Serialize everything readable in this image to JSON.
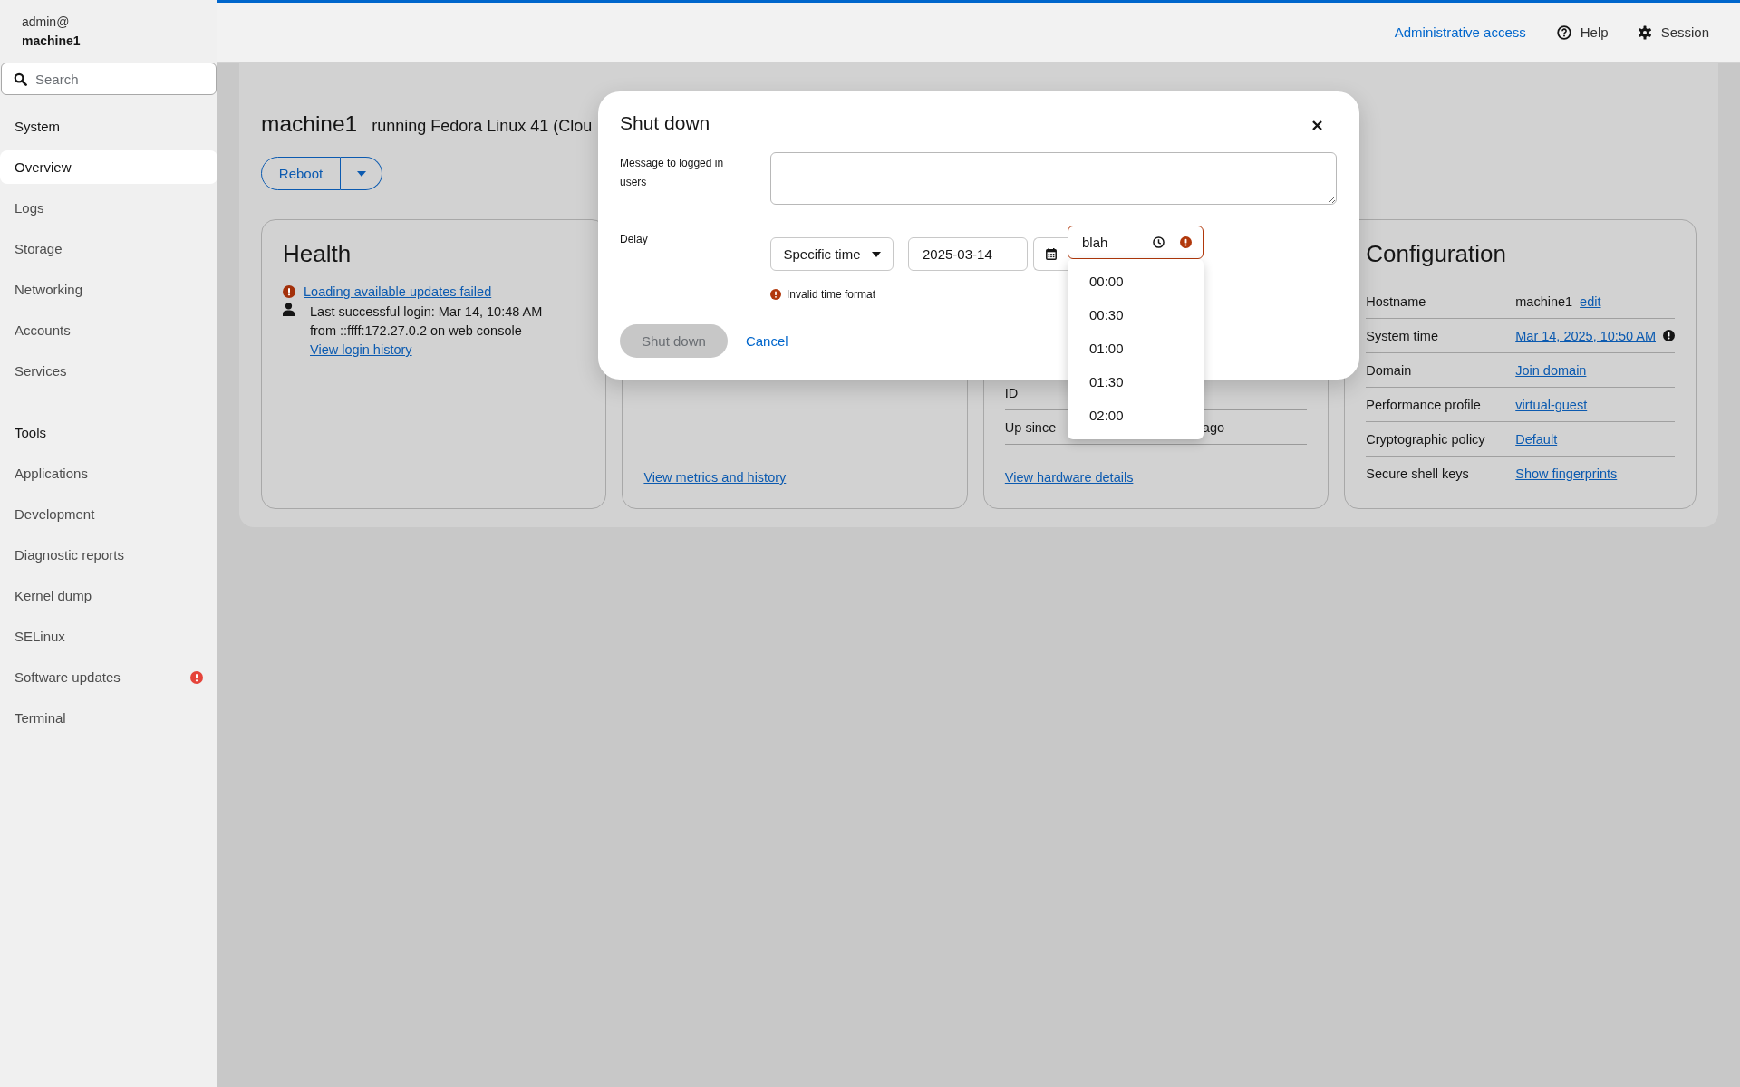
{
  "header": {
    "user": "admin@",
    "host": "machine1",
    "admin_access": "Administrative access",
    "help": "Help",
    "session": "Session"
  },
  "sidebar": {
    "search_placeholder": "Search",
    "sections": [
      {
        "title": "System",
        "items": [
          {
            "label": "Overview",
            "selected": true,
            "alert": false
          },
          {
            "label": "Logs",
            "selected": false,
            "alert": false
          },
          {
            "label": "Storage",
            "selected": false,
            "alert": false
          },
          {
            "label": "Networking",
            "selected": false,
            "alert": false
          },
          {
            "label": "Accounts",
            "selected": false,
            "alert": false
          },
          {
            "label": "Services",
            "selected": false,
            "alert": false
          }
        ]
      },
      {
        "title": "Tools",
        "items": [
          {
            "label": "Applications",
            "selected": false,
            "alert": false
          },
          {
            "label": "Development",
            "selected": false,
            "alert": false
          },
          {
            "label": "Diagnostic reports",
            "selected": false,
            "alert": false
          },
          {
            "label": "Kernel dump",
            "selected": false,
            "alert": false
          },
          {
            "label": "SELinux",
            "selected": false,
            "alert": false
          },
          {
            "label": "Software updates",
            "selected": false,
            "alert": true
          },
          {
            "label": "Terminal",
            "selected": false,
            "alert": false
          }
        ]
      }
    ]
  },
  "page": {
    "hostname": "machine1",
    "subtitle": "running Fedora Linux 41 (Clou",
    "reboot_button": "Reboot"
  },
  "cards": [
    {
      "kind": "health",
      "title": "Health",
      "error_link": "Loading available updates failed",
      "login_lines": [
        "Last successful login: Mar 14, 10:48 AM",
        "from ::ffff:172.27.0.2 on web console"
      ],
      "login_link": "View login history"
    },
    {
      "kind": "usage",
      "footer_link": "View metrics and history"
    },
    {
      "kind": "system",
      "rows": [
        {
          "label": "ID"
        },
        {
          "label": "Up since",
          "value": "ago"
        }
      ],
      "footer_link": "View hardware details"
    },
    {
      "kind": "config",
      "title": "Configuration",
      "rows": [
        {
          "label": "Hostname",
          "value": "machine1",
          "link": "edit",
          "warning": false
        },
        {
          "label": "System time",
          "link": "Mar 14, 2025, 10:50 AM",
          "warning": true
        },
        {
          "label": "Domain",
          "link": "Join domain",
          "warning": false
        },
        {
          "label": "Performance profile",
          "link": "virtual-guest",
          "warning": false
        },
        {
          "label": "Cryptographic policy",
          "link": "Default",
          "warning": false
        },
        {
          "label": "Secure shell keys",
          "link": "Show fingerprints",
          "warning": false
        }
      ]
    }
  ],
  "dialog": {
    "title": "Shut down",
    "message_label": "Message to logged in users",
    "delay_label": "Delay",
    "delay_mode": "Specific time",
    "date": "2025-03-14",
    "time": "blah",
    "time_invalid": true,
    "error": "Invalid time format",
    "time_options": [
      "00:00",
      "00:30",
      "01:00",
      "01:30",
      "02:00"
    ],
    "primary_button": "Shut down",
    "primary_disabled": true,
    "cancel": "Cancel"
  }
}
